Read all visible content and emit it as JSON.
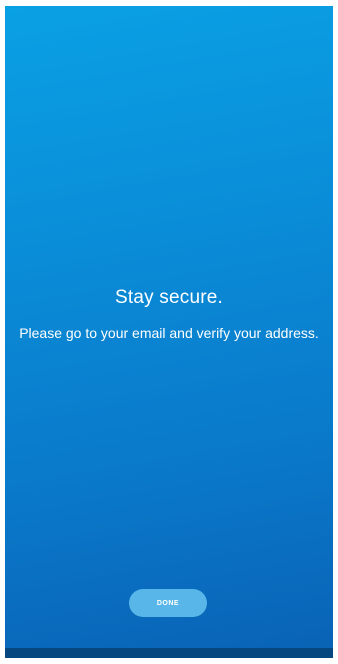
{
  "screen": {
    "title": "Stay secure.",
    "message": "Please go to your email and verify your address."
  },
  "actions": {
    "done_label": "DONE"
  },
  "colors": {
    "gradient_top": "#0aa0e4",
    "gradient_bottom": "#0962b5",
    "button_bg": "#58b7e8",
    "text": "#ffffff"
  }
}
